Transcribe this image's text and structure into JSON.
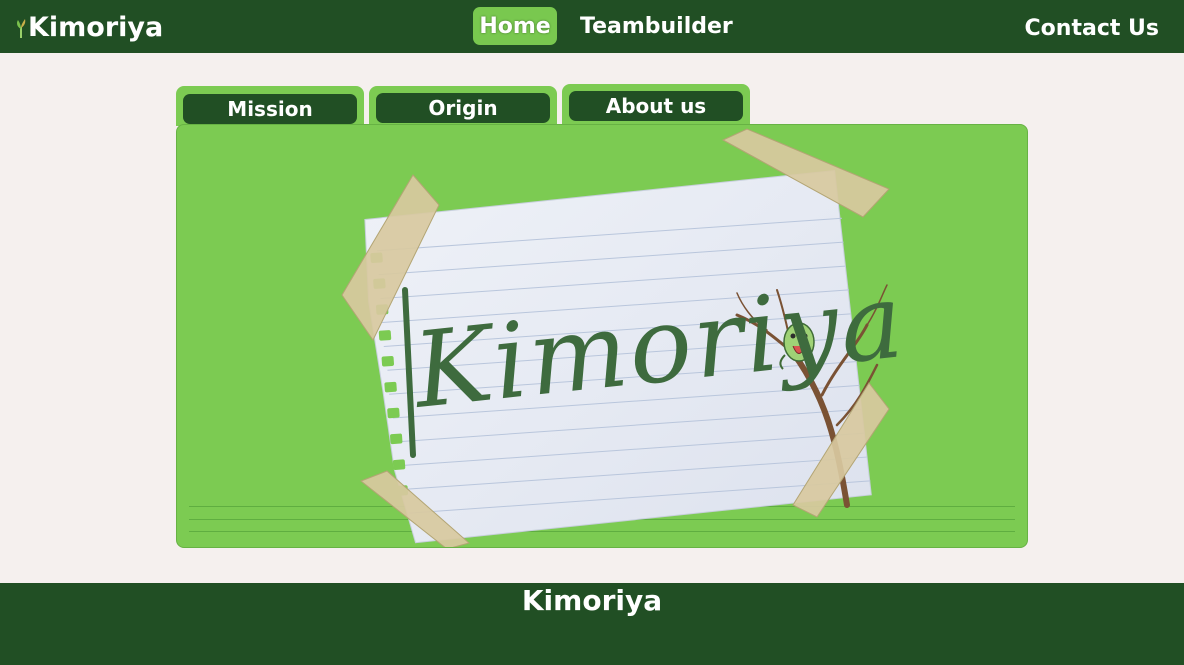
{
  "brand": {
    "name": "Kimoriya",
    "icon": "grass-sprout-icon"
  },
  "nav": {
    "home": "Home",
    "teambuilder": "Teambuilder",
    "contact": "Contact Us"
  },
  "tabs": [
    {
      "label": "Mission"
    },
    {
      "label": "Origin"
    },
    {
      "label": "About us"
    }
  ],
  "hero": {
    "handwritten_title": "Kimoriya",
    "image": "torn-notebook-paper-with-tape-and-tree"
  },
  "footer": {
    "title": "Kimoriya"
  },
  "colors": {
    "nav_bg": "#214f24",
    "accent_green": "#7ccb52",
    "page_bg": "#f5f0ee",
    "handwriting": "#3e6b3e",
    "tape": "#d7c79a"
  }
}
